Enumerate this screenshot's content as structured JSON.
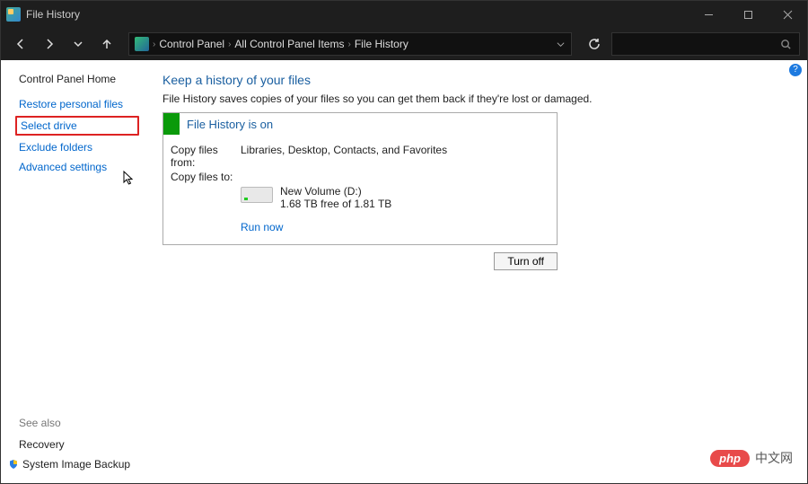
{
  "titlebar": {
    "title": "File History"
  },
  "breadcrumb": {
    "part1": "Control Panel",
    "part2": "All Control Panel Items",
    "part3": "File History"
  },
  "sidebar": {
    "home": "Control Panel Home",
    "restore": "Restore personal files",
    "select_drive": "Select drive",
    "exclude": "Exclude folders",
    "advanced": "Advanced settings",
    "see_also": "See also",
    "recovery": "Recovery",
    "system_image": "System Image Backup"
  },
  "main": {
    "heading": "Keep a history of your files",
    "description": "File History saves copies of your files so you can get them back if they're lost or damaged.",
    "status_title": "File History is on",
    "copy_from_label": "Copy files from:",
    "copy_from_value": "Libraries, Desktop, Contacts, and Favorites",
    "copy_to_label": "Copy files to:",
    "drive_name": "New Volume (D:)",
    "drive_free": "1.68 TB free of 1.81 TB",
    "run_now": "Run now",
    "turn_off": "Turn off"
  },
  "watermark": {
    "pill": "php",
    "text": "中文网"
  }
}
